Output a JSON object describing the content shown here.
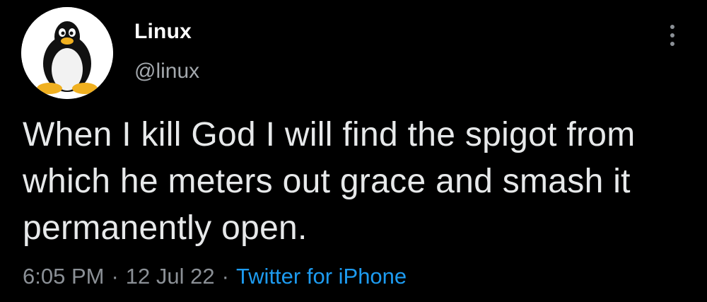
{
  "tweet": {
    "author": {
      "display_name": "Linux",
      "handle": "@linux",
      "avatar_icon": "tux-penguin-icon"
    },
    "text": "When I kill God I will find the spigot from which he meters out grace and smash it permanently open.",
    "meta": {
      "time": "6:05 PM",
      "date": "12 Jul 22",
      "separator": "·",
      "source": "Twitter for iPhone"
    },
    "more_icon": "more-vertical-icon"
  },
  "colors": {
    "background": "#000000",
    "text": "#e7e9ea",
    "muted": "#8b9096",
    "link": "#1d9bf0"
  }
}
